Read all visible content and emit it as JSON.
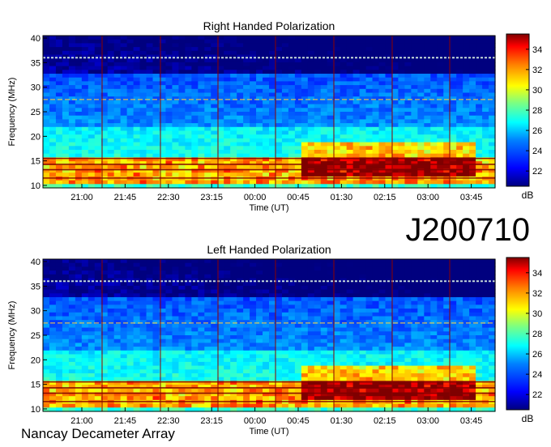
{
  "figure": {
    "observation_id": "J200710",
    "station": "Nancay Decameter Array",
    "colors": {
      "colormap": [
        "#00007f",
        "#0000ff",
        "#007fff",
        "#00ffff",
        "#7fff7f",
        "#ffff00",
        "#ff7f00",
        "#ff0000",
        "#7f0000"
      ],
      "marker_lines": "#8b0000"
    }
  },
  "chart_data": [
    {
      "type": "heatmap",
      "title": "Right Handed Polarization",
      "xlabel": "Time (UT)",
      "ylabel": "Frequency (MHz)",
      "x_tick_labels": [
        "21:00",
        "21:45",
        "22:30",
        "23:15",
        "00:00",
        "00:45",
        "01:30",
        "02:15",
        "03:00",
        "03:45"
      ],
      "y_ticks": [
        10,
        15,
        20,
        25,
        30,
        35,
        40
      ],
      "ylim": [
        9.5,
        40.5
      ],
      "colorbar": {
        "label": "dB",
        "ticks": [
          22,
          24,
          26,
          28,
          30,
          32,
          34
        ],
        "range": [
          20.5,
          35.5
        ]
      },
      "features": {
        "background_db": 25,
        "strong_emission_band_mhz": [
          10,
          16
        ],
        "emission_event_window": [
          "00:45",
          "03:45"
        ],
        "rfi_line_mhz": [
          36,
          27.5
        ]
      }
    },
    {
      "type": "heatmap",
      "title": "Left Handed Polarization",
      "xlabel": "Time (UT)",
      "ylabel": "Frequency (MHz)",
      "x_tick_labels": [
        "21:00",
        "21:45",
        "22:30",
        "23:15",
        "00:00",
        "00:45",
        "01:30",
        "02:15",
        "03:00",
        "03:45"
      ],
      "y_ticks": [
        10,
        15,
        20,
        25,
        30,
        35,
        40
      ],
      "ylim": [
        9.5,
        40.5
      ],
      "colorbar": {
        "label": "dB",
        "ticks": [
          22,
          24,
          26,
          28,
          30,
          32,
          34
        ],
        "range": [
          20.5,
          35.5
        ]
      },
      "features": {
        "background_db": 25,
        "strong_emission_band_mhz": [
          10,
          16
        ],
        "emission_event_window": [
          "00:45",
          "03:45"
        ],
        "rfi_line_mhz": [
          36,
          27.5
        ]
      }
    }
  ]
}
